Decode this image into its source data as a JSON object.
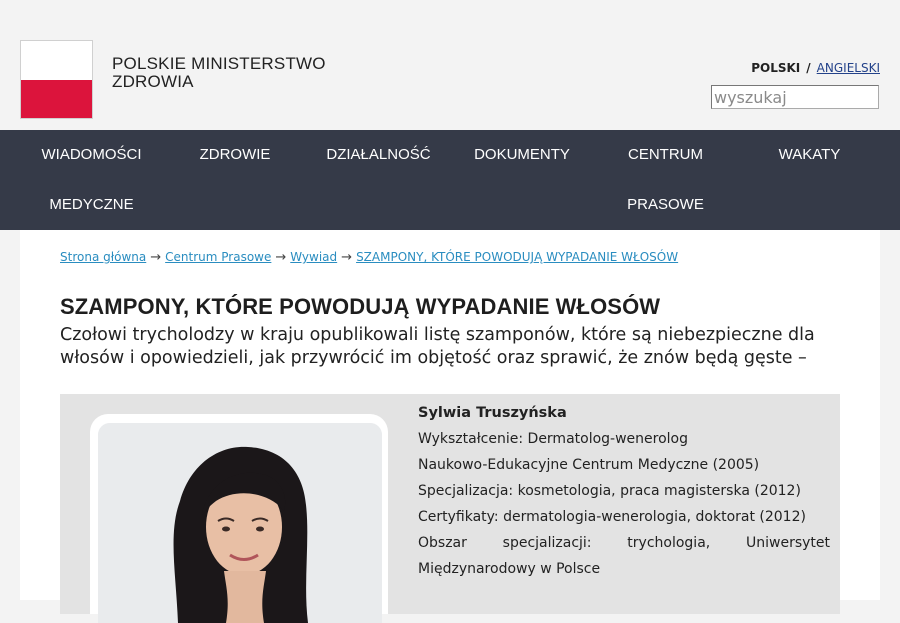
{
  "header": {
    "title_line1": "POLSKIE MINISTERSTWO",
    "title_line2": "ZDROWIA",
    "flag_colors": [
      "#ffffff",
      "#dc143c"
    ],
    "lang_active": "POLSKI",
    "lang_separator": "/",
    "lang_other": "ANGIELSKI",
    "search_placeholder": "wyszukaj"
  },
  "nav": {
    "items": [
      {
        "line1": "WIADOMOŚCI",
        "line2": "MEDYCZNE"
      },
      {
        "line1": "ZDROWIE",
        "line2": ""
      },
      {
        "line1": "DZIAŁALNOŚĆ",
        "line2": ""
      },
      {
        "line1": "DOKUMENTY",
        "line2": ""
      },
      {
        "line1": "CENTRUM",
        "line2": "PRASOWE"
      },
      {
        "line1": "WAKATY",
        "line2": ""
      }
    ]
  },
  "breadcrumb": {
    "items": [
      "Strona główna",
      "Centrum Prasowe",
      "Wywiad",
      "SZAMPONY, KTÓRE POWODUJĄ WYPADANIE WŁOSÓW"
    ],
    "arrow": "→"
  },
  "article": {
    "title": "SZAMPONY, KTÓRE POWODUJĄ WYPADANIE WŁOSÓW",
    "lead": "Czołowi trycholodzy w kraju opublikowali listę szamponów, które są niebezpieczne dla włosów i opowiedzieli, jak przywrócić im objętość oraz sprawić, że znów będą gęste –"
  },
  "profile": {
    "name": "Sylwia Truszyńska",
    "education": "Wykształcenie: Dermatolog-wenerolog",
    "institution": "Naukowo-Edukacyjne Centrum Medyczne (2005)",
    "specialization": "Specjalizacja: kosmetologia, praca magisterska (2012)",
    "certificates": "Certyfikaty: dermatologia-wenerologia, doktorat (2012)",
    "area_line1": "Obszar specjalizacji: trychologia, Uniwersytet",
    "area_line2": "Międzynarodowy w Polsce"
  }
}
